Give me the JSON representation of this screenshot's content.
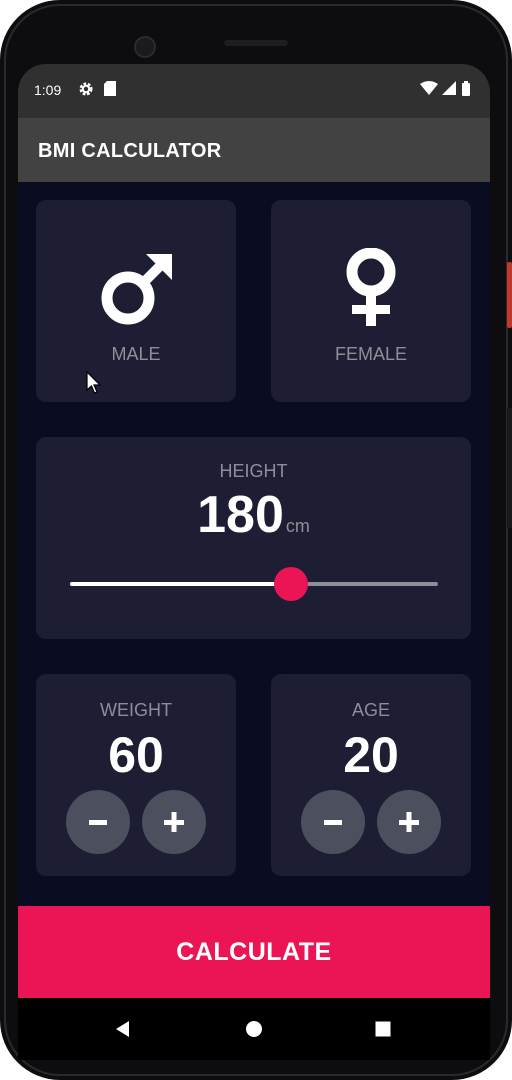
{
  "status_bar": {
    "time": "1:09",
    "left_icons": [
      "gear-icon",
      "sd-card-icon"
    ],
    "right_icons": [
      "wifi-icon",
      "signal-icon",
      "battery-icon"
    ]
  },
  "app_bar": {
    "title": "BMI CALCULATOR"
  },
  "gender": {
    "male_label": "MALE",
    "female_label": "FEMALE"
  },
  "height": {
    "label": "HEIGHT",
    "value": "180",
    "unit": "cm",
    "slider_fraction": 0.6
  },
  "weight": {
    "label": "WEIGHT",
    "value": "60",
    "minus_icon": "minus-icon",
    "plus_icon": "plus-icon"
  },
  "age": {
    "label": "AGE",
    "value": "20",
    "minus_icon": "minus-icon",
    "plus_icon": "plus-icon"
  },
  "calculate_button": {
    "label": "CALCULATE"
  },
  "nav_bar": {
    "icons": [
      "back-icon",
      "home-icon",
      "recents-icon"
    ]
  },
  "colors": {
    "background": "#0a0c22",
    "card": "#1d1e33",
    "accent": "#eb1555",
    "label_grey": "#8d8e98",
    "round_button": "#4c4f5e"
  }
}
